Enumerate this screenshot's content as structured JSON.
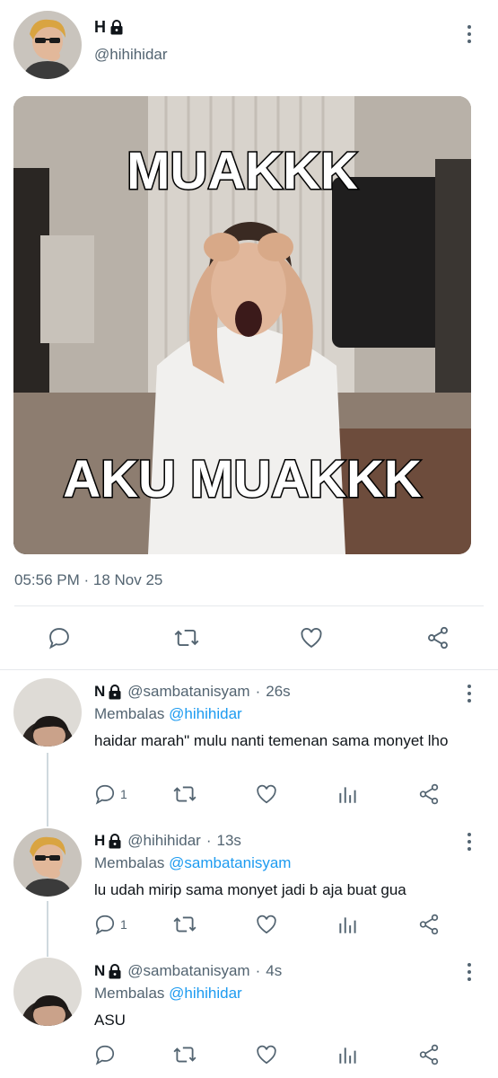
{
  "main_tweet": {
    "name": "H",
    "handle": "@hihihidar",
    "meme_top_text": "MUAKKK",
    "meme_bottom_text": "AKU MUAKKK",
    "timestamp": "05:56 PM · 18 Nov 25"
  },
  "replies": [
    {
      "name": "N",
      "handle": "@sambatanisyam",
      "time": "26s",
      "replying_label": "Membalas",
      "replying_to": "@hihihidar",
      "text": "haidar marah\" mulu nanti temenan sama monyet lho",
      "reply_count": "1"
    },
    {
      "name": "H",
      "handle": "@hihihidar",
      "time": "13s",
      "replying_label": "Membalas",
      "replying_to": "@sambatanisyam",
      "text": "lu udah mirip sama monyet jadi b aja buat gua",
      "reply_count": "1"
    },
    {
      "name": "N",
      "handle": "@sambatanisyam",
      "time": "4s",
      "replying_label": "Membalas",
      "replying_to": "@hihihidar",
      "text": "ASU",
      "reply_count": ""
    }
  ],
  "colors": {
    "text": "#0f1419",
    "secondary": "#536471",
    "link": "#1d9bf0",
    "divider": "#e6e9ec"
  }
}
